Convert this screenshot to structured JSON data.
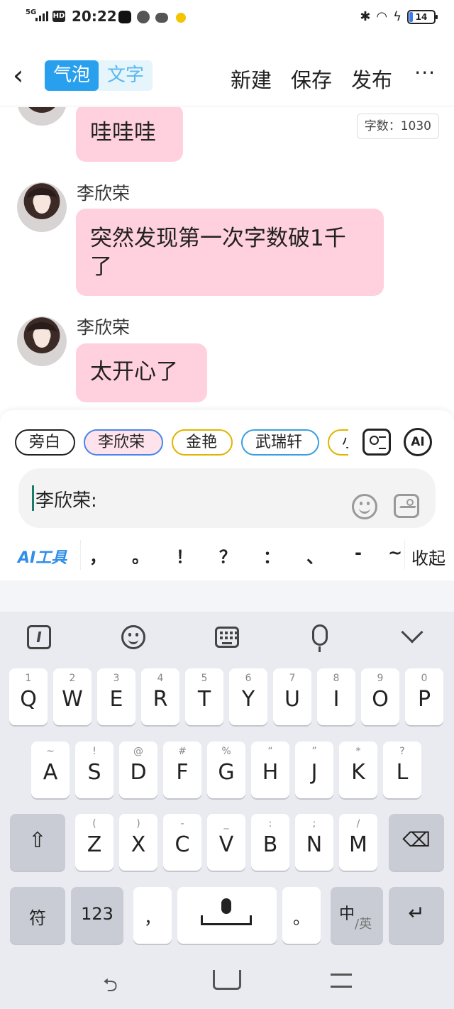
{
  "status_bar": {
    "network": "5G",
    "hd": "HD",
    "time": "20:22",
    "battery": "14"
  },
  "nav": {
    "mode_bubble": "气泡",
    "mode_text": "文字",
    "new": "新建",
    "save": "保存",
    "publish": "发布",
    "more": "···"
  },
  "chat": {
    "word_count": "字数：1030",
    "messages": [
      {
        "name": "",
        "text": "哇哇哇"
      },
      {
        "name": "李欣荣",
        "text_line1": "突然发现第一次字数破1千",
        "text_line2": "了"
      },
      {
        "name": "李欣荣",
        "text": "太开心了"
      }
    ]
  },
  "roles": [
    "旁白",
    "李欣荣",
    "金艳",
    "武瑞轩",
    "小"
  ],
  "input": {
    "value": "李欣荣:"
  },
  "punctuation": {
    "ai_tools": "AI工具",
    "marks": [
      "，",
      "。",
      "！",
      "？",
      "：",
      "、",
      "-",
      "~"
    ],
    "collapse": "收起"
  },
  "ai_label": "AI",
  "keyboard": {
    "row1": [
      {
        "hint": "1",
        "label": "Q"
      },
      {
        "hint": "2",
        "label": "W"
      },
      {
        "hint": "3",
        "label": "E"
      },
      {
        "hint": "4",
        "label": "R"
      },
      {
        "hint": "5",
        "label": "T"
      },
      {
        "hint": "6",
        "label": "Y"
      },
      {
        "hint": "7",
        "label": "U"
      },
      {
        "hint": "8",
        "label": "I"
      },
      {
        "hint": "9",
        "label": "O"
      },
      {
        "hint": "0",
        "label": "P"
      }
    ],
    "row2": [
      {
        "hint": "~",
        "label": "A"
      },
      {
        "hint": "!",
        "label": "S"
      },
      {
        "hint": "@",
        "label": "D"
      },
      {
        "hint": "#",
        "label": "F"
      },
      {
        "hint": "%",
        "label": "G"
      },
      {
        "hint": "“",
        "label": "H"
      },
      {
        "hint": "”",
        "label": "J"
      },
      {
        "hint": "*",
        "label": "K"
      },
      {
        "hint": "?",
        "label": "L"
      }
    ],
    "row3": [
      {
        "hint": "(",
        "label": "Z"
      },
      {
        "hint": ")",
        "label": "X"
      },
      {
        "hint": "-",
        "label": "C"
      },
      {
        "hint": "_",
        "label": "V"
      },
      {
        "hint": ":",
        "label": "B"
      },
      {
        "hint": ";",
        "label": "N"
      },
      {
        "hint": "/",
        "label": "M"
      }
    ],
    "symbol_key": "符",
    "num_key": "123",
    "comma_key": "，",
    "period_key": "。",
    "lang_key_main": "中",
    "lang_key_sub": "/英"
  }
}
